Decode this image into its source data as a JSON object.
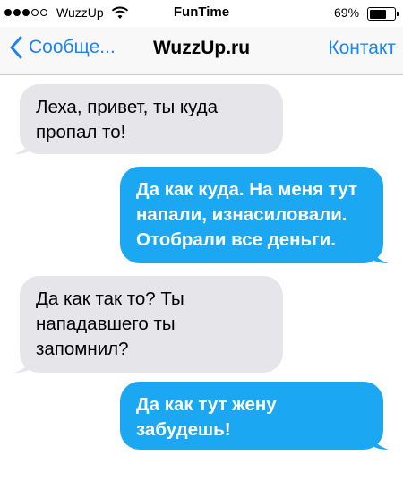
{
  "status_bar": {
    "carrier": "WuzzUp",
    "time": "FunTime",
    "battery_percent": "69%",
    "battery_level": 0.69,
    "signal_bars_filled": 3,
    "signal_bars_total": 5,
    "icons": [
      "signal-icon",
      "wifi-icon",
      "battery-icon"
    ]
  },
  "nav": {
    "back_label": "Сообще...",
    "title": "WuzzUp.ru",
    "contact_label": "Контакт",
    "accent_color": "#1f84f1"
  },
  "messages": [
    {
      "direction": "incoming",
      "text": "Леха, привет, ты куда пропал то!"
    },
    {
      "direction": "outgoing",
      "text": "Да как куда. На меня тут напали, изнасиловали. Отобрали все деньги."
    },
    {
      "direction": "incoming",
      "text": "Да как так то? Ты нападавшего ты запомнил?"
    },
    {
      "direction": "outgoing",
      "text": "Да как тут жену забудешь!"
    }
  ],
  "colors": {
    "incoming_bubble": "#e5e5ea",
    "outgoing_bubble": "#1ba7f1"
  }
}
